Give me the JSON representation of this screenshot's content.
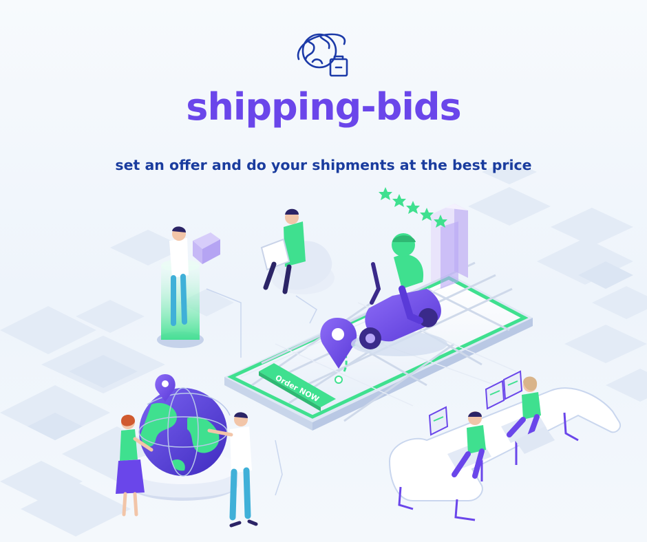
{
  "brand": {
    "name": "shipping-bids",
    "tagline": "set an offer and do your shipments at the best price"
  },
  "illustration": {
    "order_button_label": "Order NOW",
    "rating_stars": 5
  },
  "colors": {
    "brand_purple": "#6a46ea",
    "tagline_blue": "#1a3c9e",
    "accent_green": "#3fe08f",
    "accent_violet": "#7e5bf0",
    "background": "#f2f7fc"
  },
  "icons": {
    "logo": "globe-with-package-icon",
    "location": "location-pin-icon",
    "rating": "star-icon"
  }
}
